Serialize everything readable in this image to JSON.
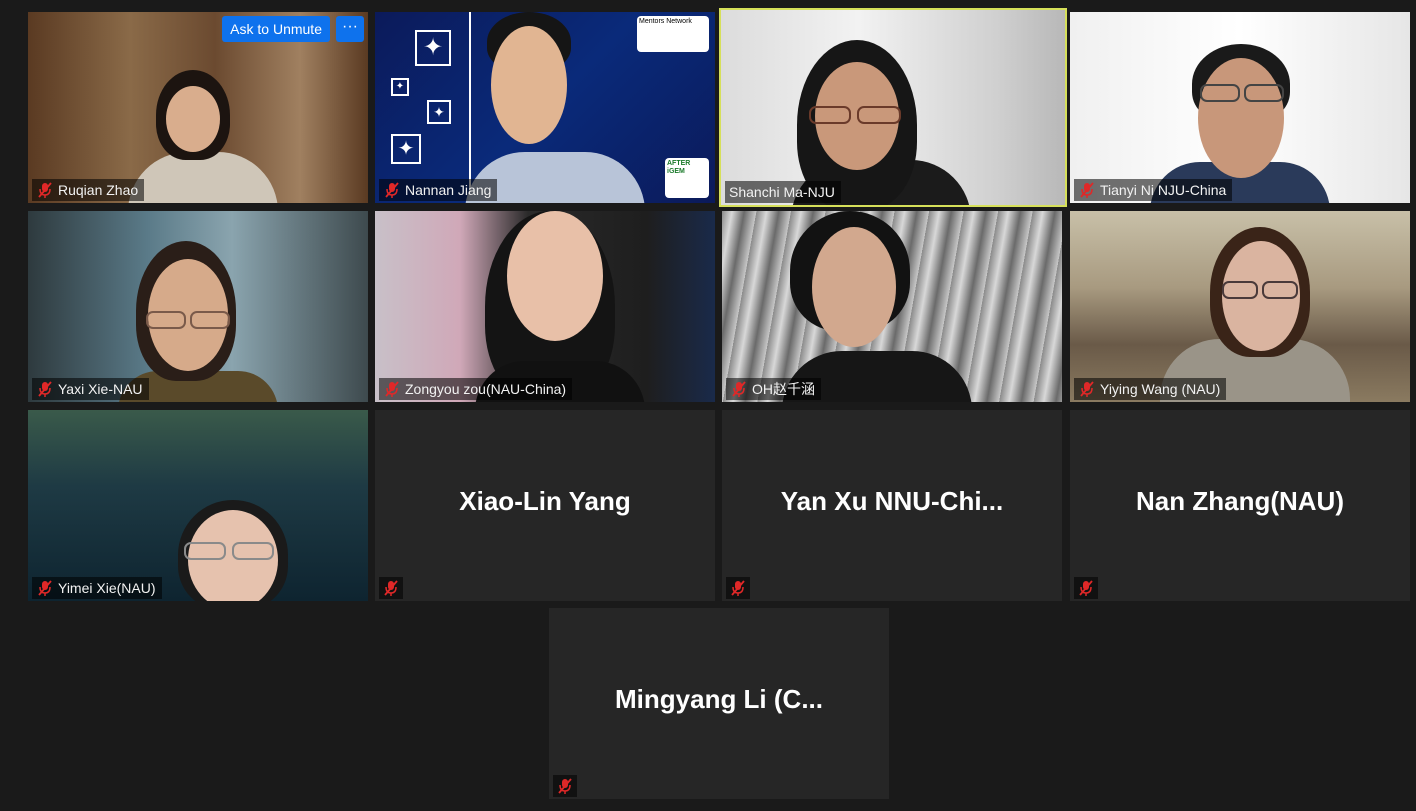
{
  "controls": {
    "ask_to_unmute": "Ask to Unmute",
    "more": "···"
  },
  "participants": [
    {
      "name": "Ruqian Zhao",
      "muted": true
    },
    {
      "name": "Nannan Jiang",
      "muted": true
    },
    {
      "name": "Shanchi Ma-NJU",
      "muted": false,
      "active_speaker": true
    },
    {
      "name": "Tianyi Ni  NJU-China",
      "muted": true
    },
    {
      "name": "Yaxi Xie-NAU",
      "muted": true
    },
    {
      "name": "Zongyou zou(NAU-China)",
      "muted": true
    },
    {
      "name": "OH赵千涵",
      "muted": true
    },
    {
      "name": "Yiying Wang (NAU)",
      "muted": true
    },
    {
      "name": "Yimei Xie(NAU)",
      "muted": true
    },
    {
      "name": "Xiao-Lin Yang",
      "muted": true,
      "video_off": true
    },
    {
      "name": "Yan  Xu  NNU-Chi...",
      "muted": true,
      "video_off": true
    },
    {
      "name": "Nan Zhang(NAU)",
      "muted": true,
      "video_off": true
    },
    {
      "name": "Mingyang  Li  (C...",
      "muted": true,
      "video_off": true
    }
  ],
  "logos": {
    "mentors_network": "Mentors Network",
    "after_igem": "AFTER iGEM",
    "igem": "iGEM"
  },
  "colors": {
    "active_border": "#d6e05a",
    "mute_red": "#e02828",
    "button_blue": "#0e72ed"
  },
  "icons": {
    "muted_mic": "mic-off-icon"
  }
}
